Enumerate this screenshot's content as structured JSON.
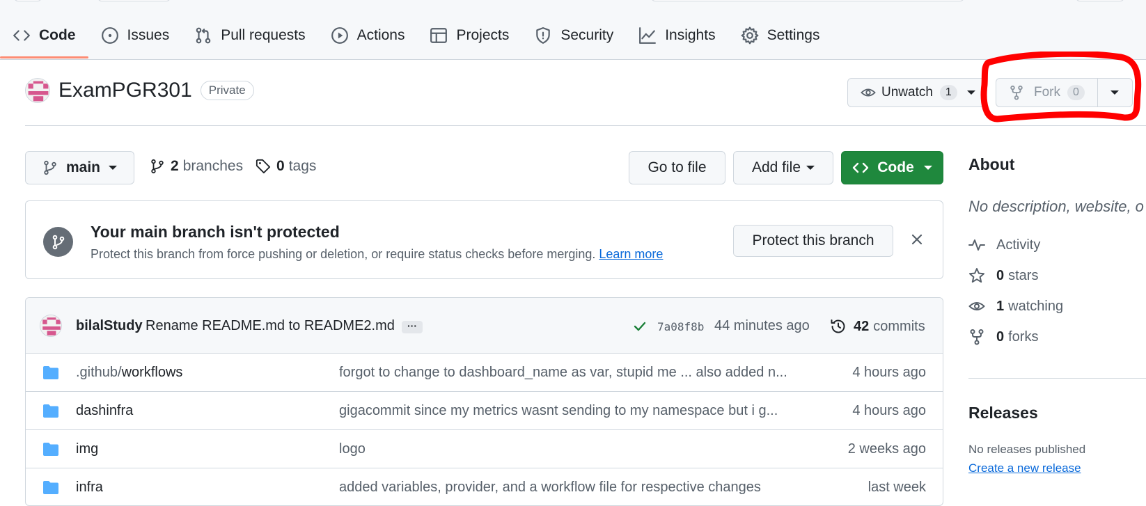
{
  "nav": {
    "tabs": [
      {
        "label": "Code",
        "icon": "code-icon"
      },
      {
        "label": "Issues",
        "icon": "issue-icon"
      },
      {
        "label": "Pull requests",
        "icon": "pull-request-icon"
      },
      {
        "label": "Actions",
        "icon": "play-icon"
      },
      {
        "label": "Projects",
        "icon": "table-icon"
      },
      {
        "label": "Security",
        "icon": "shield-icon"
      },
      {
        "label": "Insights",
        "icon": "graph-icon"
      },
      {
        "label": "Settings",
        "icon": "gear-icon"
      }
    ]
  },
  "repo": {
    "name": "ExamPGR301",
    "visibility": "Private",
    "unwatch_label": "Unwatch",
    "watch_count": "1",
    "fork_label": "Fork",
    "fork_count": "0"
  },
  "branch_bar": {
    "branch": "main",
    "branches_count": "2",
    "branches_label": "branches",
    "tags_count": "0",
    "tags_label": "tags",
    "go_to_file": "Go to file",
    "add_file": "Add file",
    "code": "Code"
  },
  "banner": {
    "title": "Your main branch isn't protected",
    "description": "Protect this branch from force pushing or deletion, or require status checks before merging.",
    "learn_more": "Learn more",
    "protect_button": "Protect this branch"
  },
  "latest_commit": {
    "author": "bilalStudy",
    "message": "Rename README.md to README2.md",
    "ellipsis": "···",
    "sha": "7a08f8b",
    "time": "44 minutes ago",
    "commits_count": "42",
    "commits_label": "commits"
  },
  "files": [
    {
      "dir": ".github/",
      "name": "workflows",
      "message": "forgot to change to dashboard_name as var, stupid me ... also added n...",
      "time": "4 hours ago"
    },
    {
      "dir": "",
      "name": "dashinfra",
      "message": "gigacommit since my metrics wasnt sending to my namespace but i g...",
      "time": "4 hours ago"
    },
    {
      "dir": "",
      "name": "img",
      "message": "logo",
      "time": "2 weeks ago"
    },
    {
      "dir": "",
      "name": "infra",
      "message": "added variables, provider, and a workflow file for respective changes",
      "time": "last week"
    }
  ],
  "about": {
    "title": "About",
    "description": "No description, website, o",
    "activity": "Activity",
    "stars_count": "0",
    "stars_label": "stars",
    "watching_count": "1",
    "watching_label": "watching",
    "forks_count": "0",
    "forks_label": "forks"
  },
  "releases": {
    "title": "Releases",
    "none": "No releases published",
    "create": "Create a new release"
  },
  "colors": {
    "primary_green": "#1f883d",
    "link_blue": "#0969da",
    "annotation_red": "#ff0000",
    "folder_blue": "#54aeff",
    "active_tab_underline": "#fd8c73"
  }
}
